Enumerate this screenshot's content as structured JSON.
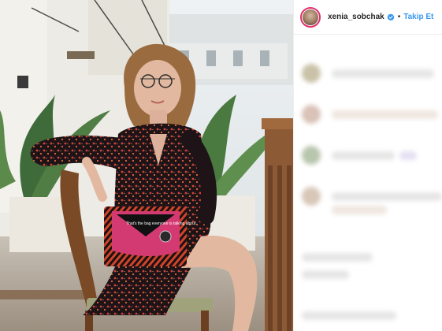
{
  "post": {
    "media_alt": "photo",
    "username": "xenia_sobchak",
    "separator": "•",
    "follow_label": "Takip Et",
    "bag_text": "That's the bag everyone is talking about"
  },
  "colors": {
    "follow": "#3897f0",
    "avatar_ring": "#e1306c",
    "verified": "#3897f0"
  },
  "icons": {
    "verified": "verified-badge-icon"
  }
}
